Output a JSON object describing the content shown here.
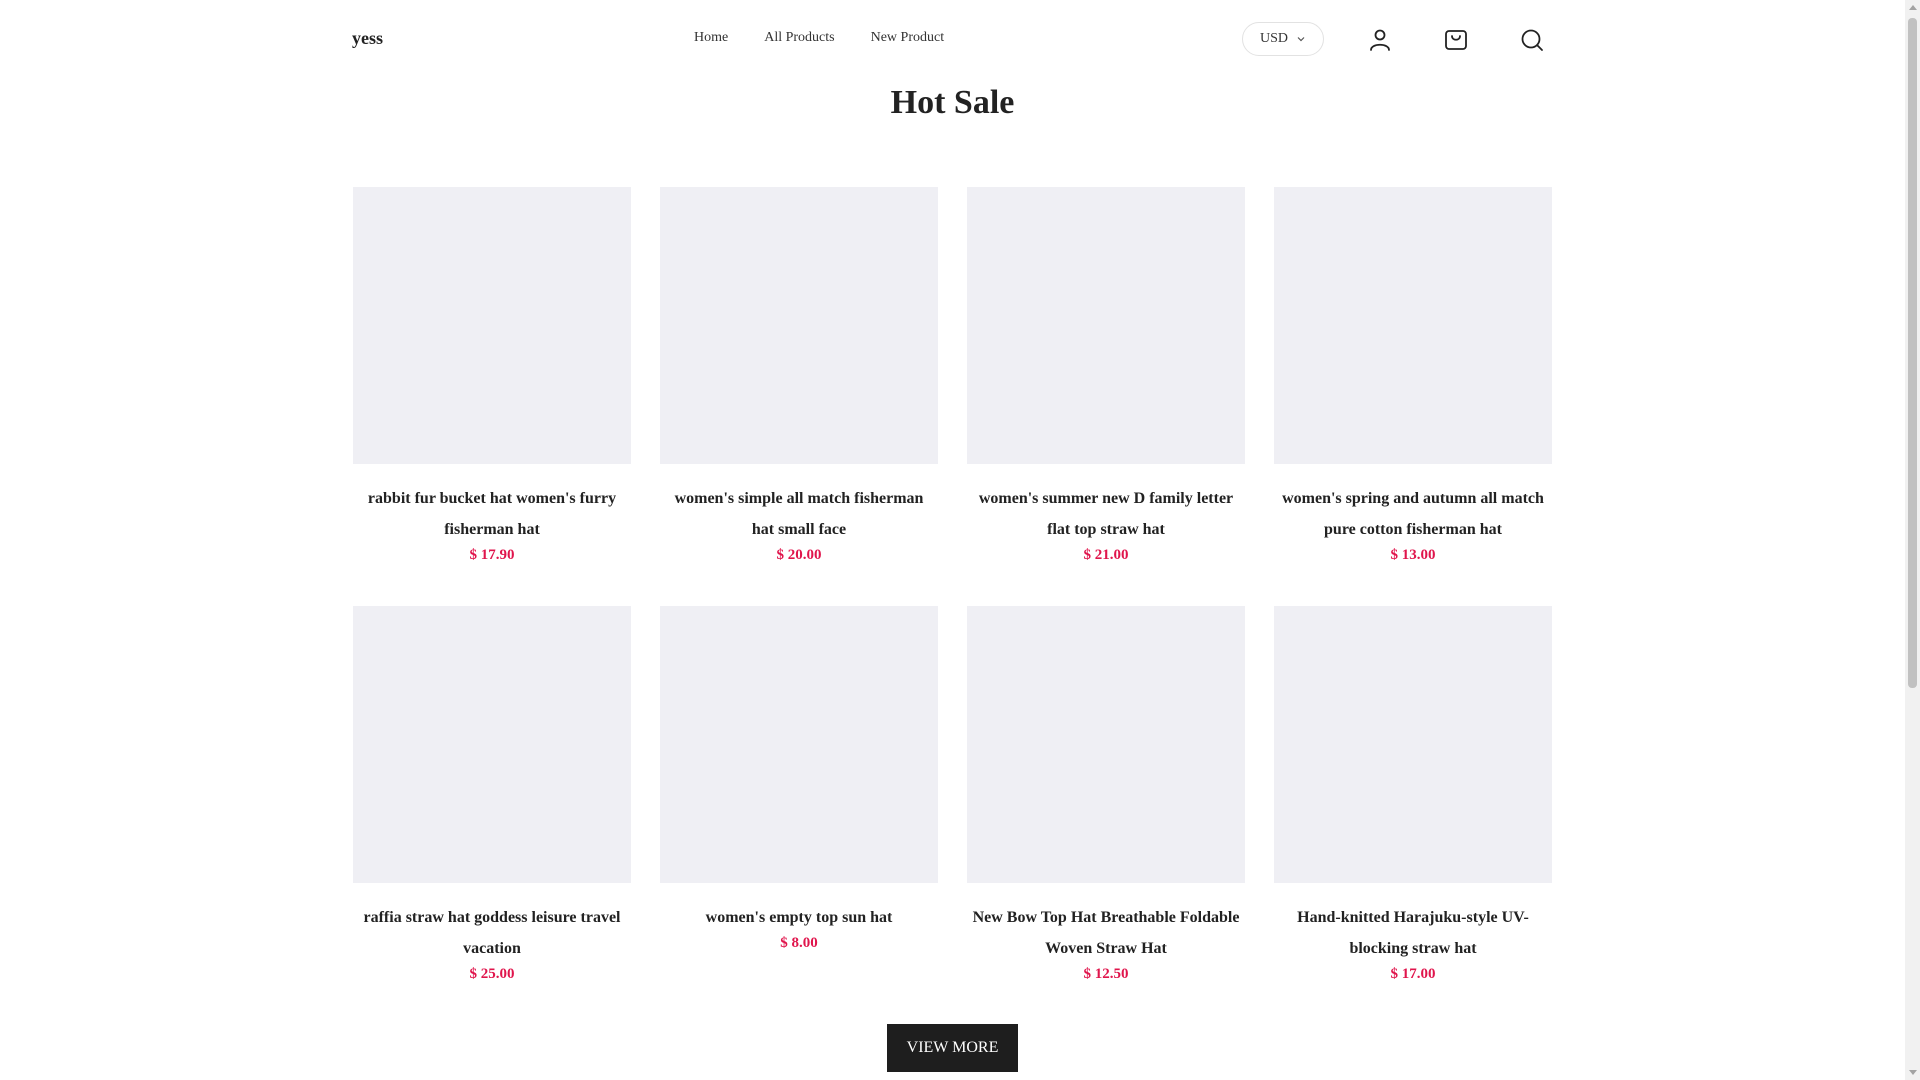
{
  "header": {
    "logo": "yess",
    "nav": [
      {
        "label": "Home"
      },
      {
        "label": "All Products"
      },
      {
        "label": "New Product"
      }
    ],
    "currency": "USD",
    "icons": [
      "user-icon",
      "cart-icon",
      "search-icon"
    ]
  },
  "section": {
    "title": "Hot Sale",
    "products": [
      {
        "name": "rabbit fur bucket hat women's furry fisherman hat",
        "price": "$ 17.90"
      },
      {
        "name": "women's simple all match fisherman hat small face",
        "price": "$ 20.00"
      },
      {
        "name": "women's summer new D family letter flat top straw hat",
        "price": "$ 21.00"
      },
      {
        "name": "women's spring and autumn all match pure cotton fisherman hat",
        "price": "$ 13.00"
      },
      {
        "name": "raffia straw hat goddess leisure travel vacation",
        "price": "$ 25.00"
      },
      {
        "name": "women's empty top sun hat",
        "price": "$ 8.00"
      },
      {
        "name": "New Bow Top Hat Breathable Foldable Woven Straw Hat",
        "price": "$ 12.50"
      },
      {
        "name": "Hand-knitted Harajuku-style UV-blocking straw hat",
        "price": "$ 17.00"
      }
    ],
    "view_more": "VIEW MORE"
  },
  "colors": {
    "price": "#e0154c",
    "thumb_placeholder": "#efeff4",
    "button_bg": "#1e1e1e"
  }
}
